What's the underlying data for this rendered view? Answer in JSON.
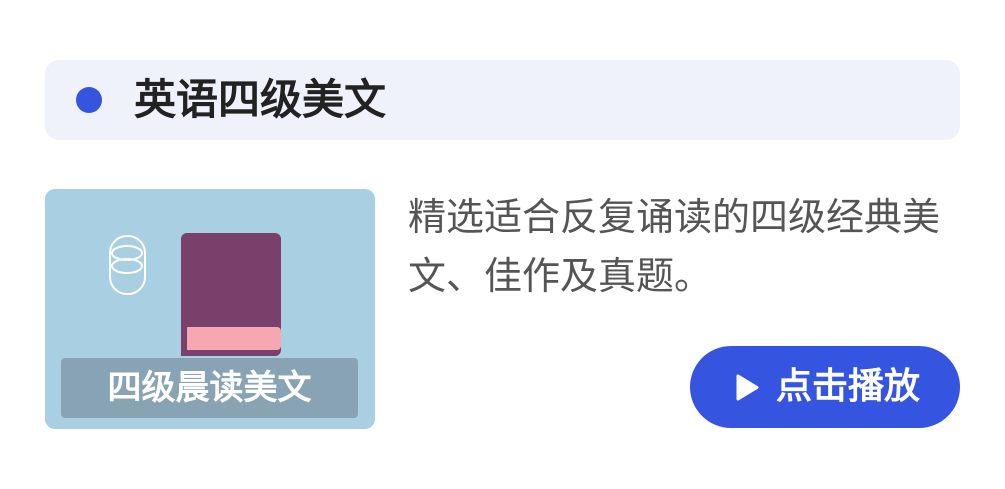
{
  "header": {
    "title": "英语四级美文"
  },
  "course": {
    "thumbnail_caption": "四级晨读美文",
    "description": "精选适合反复诵读的四级经典美文、佳作及真题。",
    "play_button_label": "点击播放",
    "icons": {
      "bullet": "bullet-dot-icon",
      "thumbnail": [
        "cup-illustration",
        "book-illustration"
      ],
      "play": "play-triangle-icon"
    }
  },
  "colors": {
    "accent": "#3554e0",
    "header_background": "#f0f2fb",
    "thumbnail_background": "#a9cfe3",
    "book_cover": "#7a3f6b",
    "book_pages": "#f5a8b2",
    "title_text": "#222222",
    "body_text": "#555555"
  }
}
